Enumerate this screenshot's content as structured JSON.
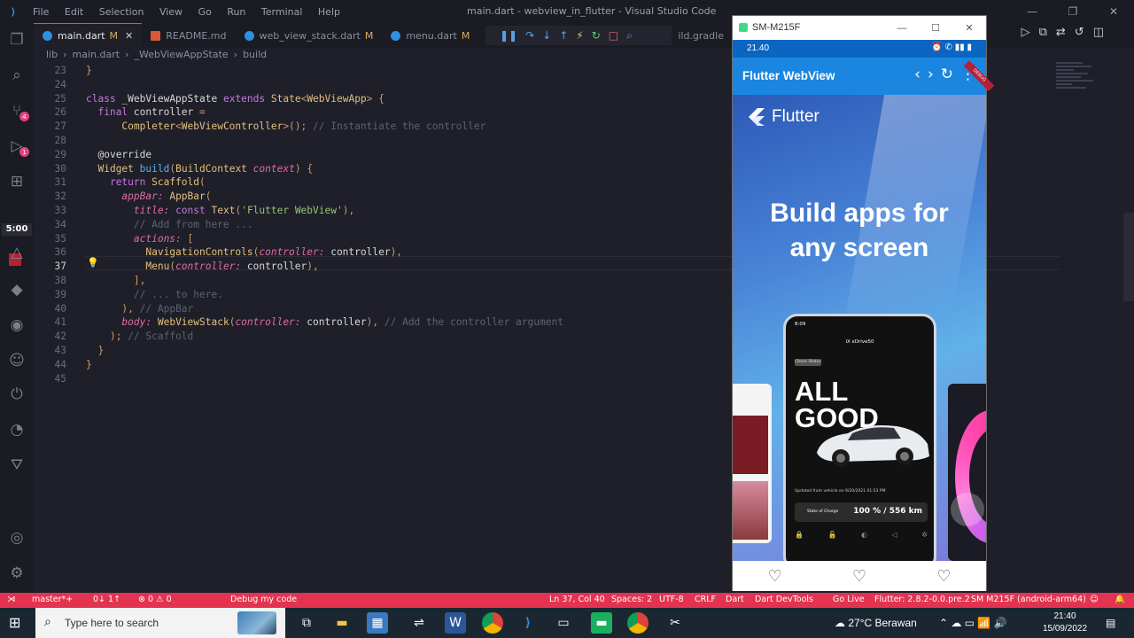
{
  "window": {
    "title": "main.dart - webview_in_flutter - Visual Studio Code",
    "menu": [
      "File",
      "Edit",
      "Selection",
      "View",
      "Go",
      "Run",
      "Terminal",
      "Help"
    ]
  },
  "tabs": [
    {
      "label": "main.dart",
      "mod": "M",
      "active": true
    },
    {
      "label": "README.md",
      "mod": ""
    },
    {
      "label": "web_view_stack.dart",
      "mod": "M"
    },
    {
      "label": "menu.dart",
      "mod": "M"
    },
    {
      "label": "ild.gradle",
      "mod": ""
    }
  ],
  "breadcrumb": [
    "lib",
    "main.dart",
    "_WebViewAppState",
    "build"
  ],
  "activity": {
    "timer": "5:00",
    "badge1": "4",
    "badge2": "1"
  },
  "editor": {
    "current_line": 37,
    "lines": [
      {
        "n": "23",
        "text": "}"
      },
      {
        "n": "24",
        "text": ""
      },
      {
        "n": "25",
        "text": "class _WebViewAppState extends State<WebViewApp> {"
      },
      {
        "n": "26",
        "text": "  final controller ="
      },
      {
        "n": "27",
        "text": "      Completer<WebViewController>(); // Instantiate the controller"
      },
      {
        "n": "28",
        "text": ""
      },
      {
        "n": "29",
        "text": "  @override"
      },
      {
        "n": "30",
        "text": "  Widget build(BuildContext context) {"
      },
      {
        "n": "31",
        "text": "    return Scaffold("
      },
      {
        "n": "32",
        "text": "      appBar: AppBar("
      },
      {
        "n": "33",
        "text": "        title: const Text('Flutter WebView'),"
      },
      {
        "n": "34",
        "text": "        // Add from here ..."
      },
      {
        "n": "35",
        "text": "        actions: ["
      },
      {
        "n": "36",
        "text": "          NavigationControls(controller: controller),"
      },
      {
        "n": "37",
        "text": "          Menu(controller: controller),"
      },
      {
        "n": "38",
        "text": "        ],"
      },
      {
        "n": "39",
        "text": "        // ... to here."
      },
      {
        "n": "40",
        "text": "      ), // AppBar"
      },
      {
        "n": "41",
        "text": "      body: WebViewStack(controller: controller), // Add the controller argument"
      },
      {
        "n": "42",
        "text": "    ); // Scaffold"
      },
      {
        "n": "43",
        "text": "  }"
      },
      {
        "n": "44",
        "text": "}"
      },
      {
        "n": "45",
        "text": ""
      }
    ]
  },
  "statusbar": {
    "branch": "master*+",
    "sync": "0↓ 1↑",
    "problems": "⊗ 0 ⚠ 0",
    "debug": "Debug my code",
    "position": "Ln 37, Col 40",
    "spaces": "Spaces: 2",
    "encoding": "UTF-8",
    "eol": "CRLF",
    "language": "Dart",
    "devtools": "Dart DevTools",
    "golive": "Go Live",
    "flutter": "Flutter: 2.8.2-0.0.pre.2",
    "device": "SM M215F (android-arm64)"
  },
  "emulator": {
    "window_title": "SM-M215F",
    "status_time": "21.40",
    "app_title": "Flutter WebView",
    "ribbon": "DEBUG",
    "site_logo_text": "Flutter",
    "headline_line1": "Build apps for",
    "headline_line2": "any screen",
    "mock": {
      "time": "8:09",
      "title": "iX xDrive50",
      "check": "Check Status",
      "big1": "ALL",
      "big2": "GOOD",
      "updated": "Updated from vehicle on 9/20/2021 01:53 PM",
      "charge_label": "State of Charge",
      "charge_value": "100 % / 556 km"
    }
  },
  "taskbar": {
    "search_placeholder": "Type here to search",
    "weather": "27°C  Berawan",
    "time": "21:40",
    "date": "15/09/2022"
  },
  "colors": {
    "accent": "#2f8fe0",
    "statusbar": "#e43350",
    "appbar": "#1a86e0"
  }
}
